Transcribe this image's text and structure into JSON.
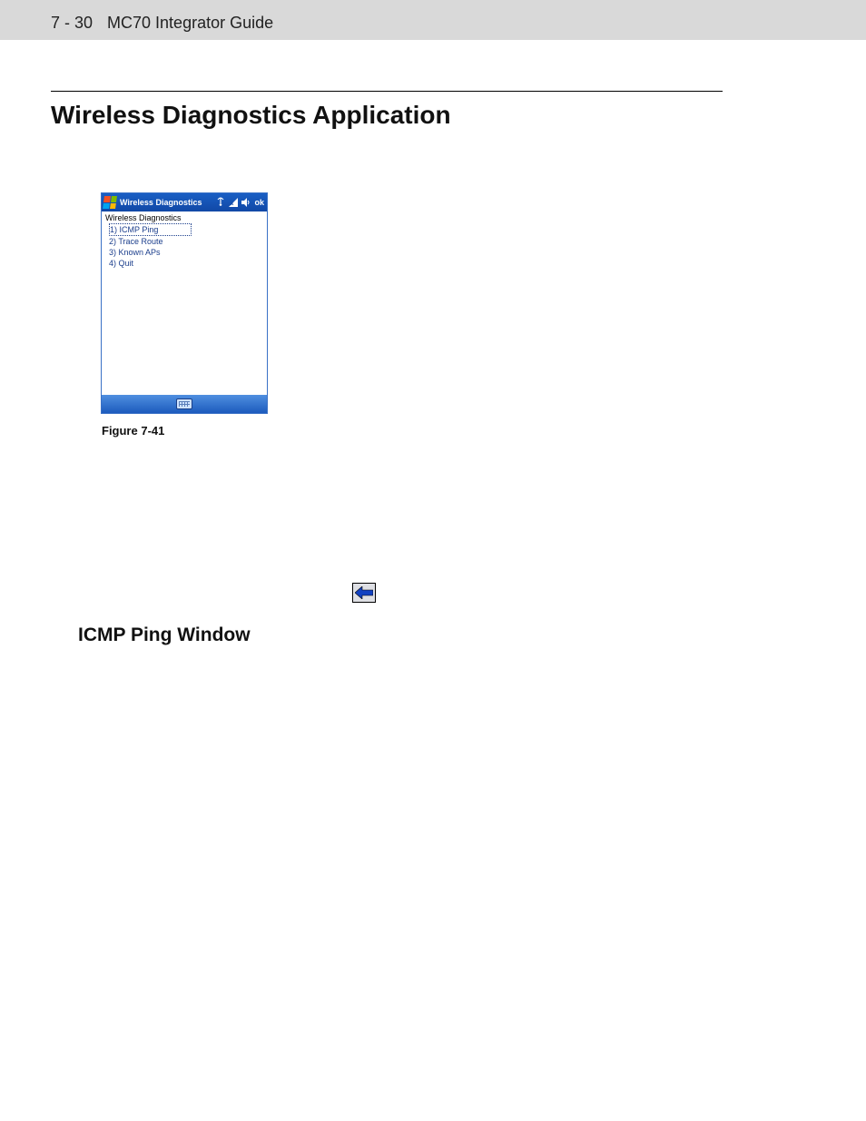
{
  "header": {
    "page_number": "7 - 30",
    "guide_title": "MC70 Integrator Guide"
  },
  "section_title": "Wireless Diagnostics Application",
  "device": {
    "titlebar": {
      "app_title": "Wireless Diagnostics",
      "ok_label": "ok"
    },
    "body": {
      "heading": "Wireless Diagnostics",
      "menu": [
        "1) ICMP Ping",
        "2) Trace Route",
        "3) Known APs",
        "4) Quit"
      ]
    }
  },
  "figure_caption": "Figure 7-41",
  "subsection_title": "ICMP Ping Window",
  "icons": {
    "windows_flag": "windows-flag-icon",
    "cellular": "cellular-icon",
    "signal": "signal-strength-icon",
    "speaker": "speaker-icon",
    "keyboard": "keyboard-icon",
    "back_arrow": "back-arrow-icon"
  }
}
